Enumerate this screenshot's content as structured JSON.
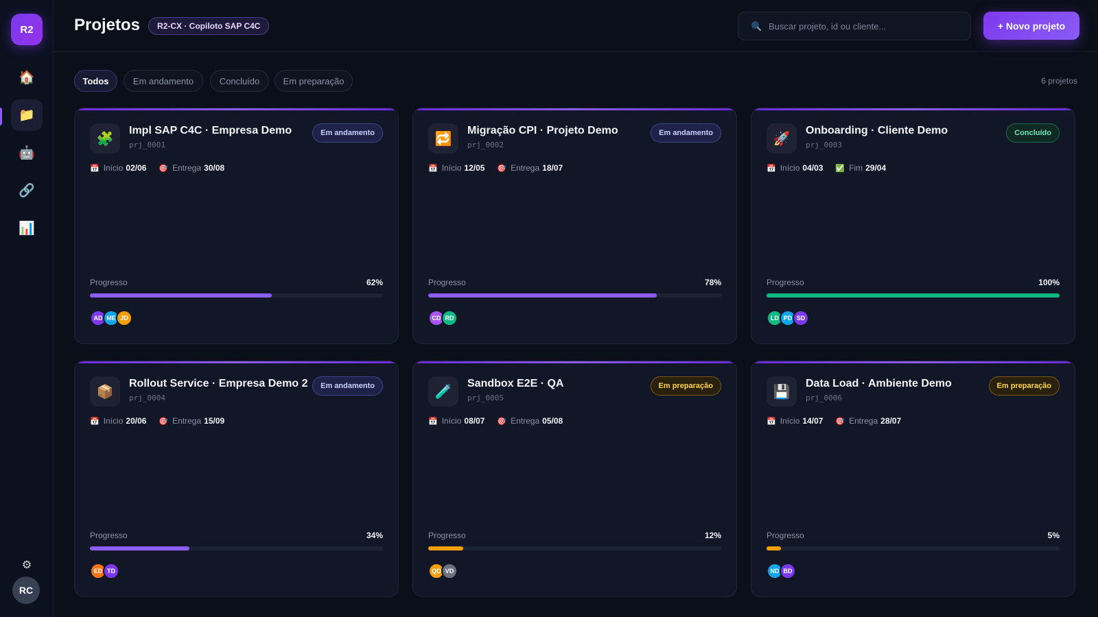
{
  "app": {
    "logo": "R2",
    "page_title": "Projetos",
    "context_badge": "R2-CX · Copiloto SAP C4C",
    "search_placeholder": "Buscar projeto, id ou cliente...",
    "new_project_label": "+ Novo projeto",
    "project_count": "6 projetos",
    "user_initials": "RC"
  },
  "colors": {
    "accent": "#7c3aed",
    "success": "#10b981",
    "warning": "#f59e0b"
  },
  "sidebar": {
    "items": [
      {
        "icon": "home-icon",
        "glyph": "🏠",
        "active": false
      },
      {
        "icon": "folder-icon",
        "glyph": "📁",
        "active": true
      },
      {
        "icon": "robot-icon",
        "glyph": "🤖",
        "active": false
      },
      {
        "icon": "link-icon",
        "glyph": "🔗",
        "active": false
      },
      {
        "icon": "chart-icon",
        "glyph": "📊",
        "active": false
      }
    ],
    "settings_icon": "⚙"
  },
  "filters": [
    "Todos",
    "Em andamento",
    "Concluído",
    "Em preparação"
  ],
  "projects": [
    {
      "title": "Impl SAP C4C · Empresa Demo",
      "id": "prj_0001",
      "icon": "puzzle-icon",
      "glyph": "🧩",
      "status": "Em andamento",
      "status_kind": "progress",
      "d1_icon": "📅",
      "d1_label": "Início",
      "d1_value": "02/06",
      "d2_icon": "🎯",
      "d2_label": "Entrega",
      "d2_value": "30/08",
      "progress_label": "Progresso",
      "progress": 62,
      "progress_text": "62%",
      "bar_color": "#8b5cf6",
      "members": [
        {
          "i": "AD",
          "c": "#7c3aed"
        },
        {
          "i": "ME",
          "c": "#0ea5e9"
        },
        {
          "i": "JD",
          "c": "#f59e0b"
        }
      ]
    },
    {
      "title": "Migração CPI · Projeto Demo",
      "id": "prj_0002",
      "icon": "sync-icon",
      "glyph": "🔁",
      "status": "Em andamento",
      "status_kind": "progress",
      "d1_icon": "📅",
      "d1_label": "Início",
      "d1_value": "12/05",
      "d2_icon": "🎯",
      "d2_label": "Entrega",
      "d2_value": "18/07",
      "progress_label": "Progresso",
      "progress": 78,
      "progress_text": "78%",
      "bar_color": "#8b5cf6",
      "members": [
        {
          "i": "CD",
          "c": "#a855f7"
        },
        {
          "i": "RD",
          "c": "#10b981"
        }
      ]
    },
    {
      "title": "Onboarding · Cliente Demo",
      "id": "prj_0003",
      "icon": "rocket-icon",
      "glyph": "🚀",
      "status": "Concluído",
      "status_kind": "done",
      "d1_icon": "📅",
      "d1_label": "Início",
      "d1_value": "04/03",
      "d2_icon": "✅",
      "d2_label": "Fim",
      "d2_value": "29/04",
      "progress_label": "Progresso",
      "progress": 100,
      "progress_text": "100%",
      "bar_color": "#10b981",
      "members": [
        {
          "i": "LD",
          "c": "#10b981"
        },
        {
          "i": "PD",
          "c": "#0ea5e9"
        },
        {
          "i": "SD",
          "c": "#7c3aed"
        }
      ]
    },
    {
      "title": "Rollout Service · Empresa Demo 2",
      "id": "prj_0004",
      "icon": "package-icon",
      "glyph": "📦",
      "status": "Em andamento",
      "status_kind": "progress",
      "d1_icon": "📅",
      "d1_label": "Início",
      "d1_value": "20/06",
      "d2_icon": "🎯",
      "d2_label": "Entrega",
      "d2_value": "15/09",
      "progress_label": "Progresso",
      "progress": 34,
      "progress_text": "34%",
      "bar_color": "#8b5cf6",
      "members": [
        {
          "i": "ED",
          "c": "#f97316"
        },
        {
          "i": "TD",
          "c": "#7c3aed"
        }
      ]
    },
    {
      "title": "Sandbox E2E · QA",
      "id": "prj_0005",
      "icon": "test-tube-icon",
      "glyph": "🧪",
      "status": "Em preparação",
      "status_kind": "prep",
      "d1_icon": "📅",
      "d1_label": "Início",
      "d1_value": "08/07",
      "d2_icon": "🎯",
      "d2_label": "Entrega",
      "d2_value": "05/08",
      "progress_label": "Progresso",
      "progress": 12,
      "progress_text": "12%",
      "bar_color": "#f59e0b",
      "members": [
        {
          "i": "QD",
          "c": "#f59e0b"
        },
        {
          "i": "VD",
          "c": "#6b7280"
        }
      ]
    },
    {
      "title": "Data Load · Ambiente Demo",
      "id": "prj_0006",
      "icon": "floppy-disk-icon",
      "glyph": "💾",
      "status": "Em preparação",
      "status_kind": "prep",
      "d1_icon": "📅",
      "d1_label": "Início",
      "d1_value": "14/07",
      "d2_icon": "🎯",
      "d2_label": "Entrega",
      "d2_value": "28/07",
      "progress_label": "Progresso",
      "progress": 5,
      "progress_text": "5%",
      "bar_color": "#f59e0b",
      "members": [
        {
          "i": "ND",
          "c": "#0ea5e9"
        },
        {
          "i": "BD",
          "c": "#7c3aed"
        }
      ]
    }
  ]
}
